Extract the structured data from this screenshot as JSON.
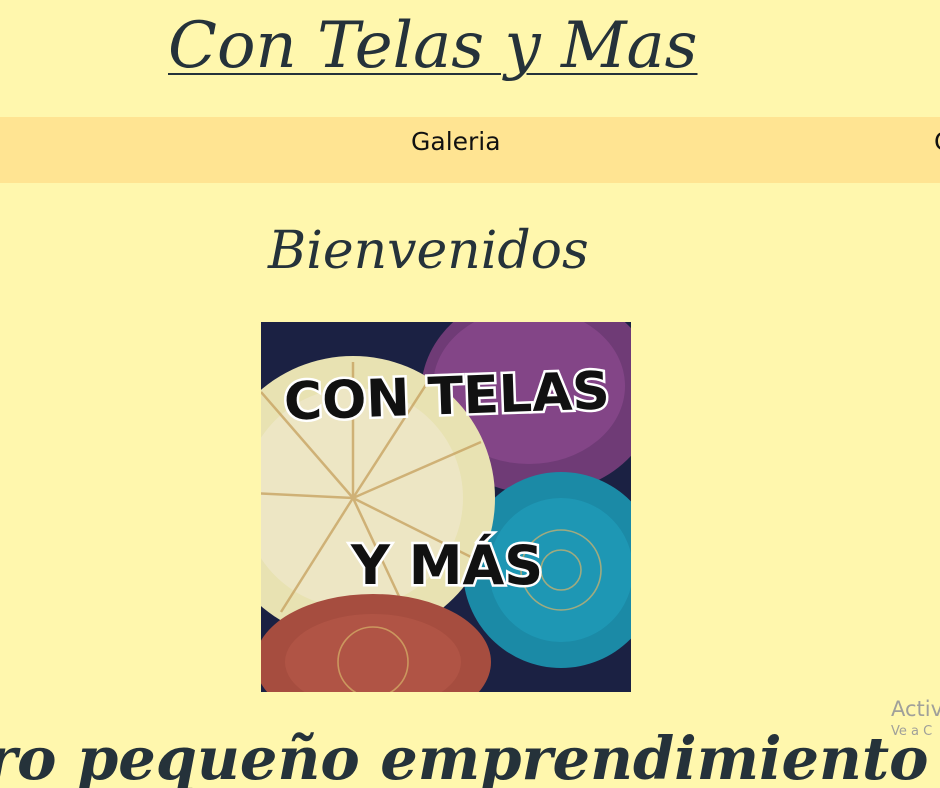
{
  "site": {
    "title": "Con Telas y Mas"
  },
  "nav": {
    "items": [
      {
        "label": "Galeria"
      },
      {
        "label": "C"
      }
    ]
  },
  "main": {
    "welcome": "Bienvenidos",
    "logo_text_line1": "CON TELAS",
    "logo_text_line2": "Y MÁS",
    "tagline": "ro pequeño emprendimiento arte"
  },
  "overlay": {
    "activate_title": "Activ",
    "activate_subtitle": "Ve a C"
  },
  "colors": {
    "background": "#fff7ad",
    "nav_background": "#ffe492",
    "text": "#25323a"
  },
  "icons": {
    "logo": "fabric-circles-logo"
  }
}
